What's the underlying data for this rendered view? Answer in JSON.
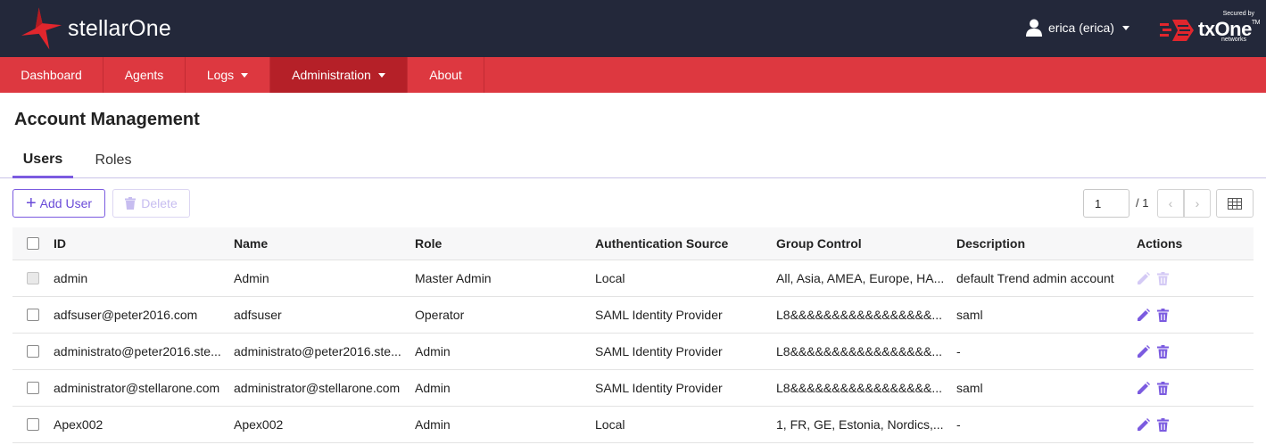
{
  "app": {
    "name": "stellarOne"
  },
  "header": {
    "user_label": "erica (erica)",
    "partner": {
      "secured_by": "Secured by",
      "brand": "txOne",
      "trademark": "TM",
      "sub": "networks"
    }
  },
  "nav": {
    "dashboard": "Dashboard",
    "agents": "Agents",
    "logs": "Logs",
    "administration": "Administration",
    "about": "About"
  },
  "page": {
    "title": "Account Management"
  },
  "tabs": {
    "users": "Users",
    "roles": "Roles"
  },
  "toolbar": {
    "add_user": "Add User",
    "delete": "Delete"
  },
  "pagination": {
    "current": "1",
    "total": "/ 1"
  },
  "table": {
    "headers": {
      "id": "ID",
      "name": "Name",
      "role": "Role",
      "auth": "Authentication Source",
      "group": "Group Control",
      "desc": "Description",
      "actions": "Actions"
    },
    "rows": [
      {
        "id": "admin",
        "name": "Admin",
        "role": "Master Admin",
        "auth": "Local",
        "group": "All, Asia, AMEA, Europe, HA...",
        "desc": "default Trend admin account",
        "editable": false
      },
      {
        "id": "adfsuser@peter2016.com",
        "name": "adfsuser",
        "role": "Operator",
        "auth": "SAML Identity Provider",
        "group": "L8&&&&&&&&&&&&&&&&&...",
        "desc": "saml",
        "editable": true
      },
      {
        "id": "administrato@peter2016.ste...",
        "name": "administrato@peter2016.ste...",
        "role": "Admin",
        "auth": "SAML Identity Provider",
        "group": "L8&&&&&&&&&&&&&&&&&...",
        "desc": "-",
        "editable": true
      },
      {
        "id": "administrator@stellarone.com",
        "name": "administrator@stellarone.com",
        "role": "Admin",
        "auth": "SAML Identity Provider",
        "group": "L8&&&&&&&&&&&&&&&&&...",
        "desc": "saml",
        "editable": true
      },
      {
        "id": "Apex002",
        "name": "Apex002",
        "role": "Admin",
        "auth": "Local",
        "group": "1, FR, GE, Estonia, Nordics,...",
        "desc": "-",
        "editable": true
      }
    ]
  },
  "colors": {
    "header_bg": "#23283a",
    "nav_bg": "#dd3840",
    "nav_active": "#b52028",
    "accent": "#7b5be0",
    "brand_red": "#e1262d"
  },
  "icons": {
    "logo": "stellar-logo-icon",
    "user": "user-icon",
    "add": "plus-icon",
    "delete": "trash-icon",
    "edit": "pencil-icon",
    "columns": "grid-icon"
  }
}
